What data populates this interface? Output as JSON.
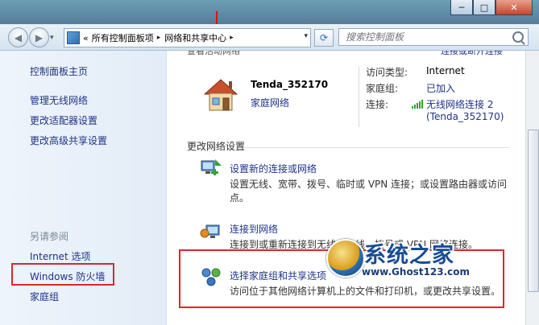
{
  "window": {
    "minimize": "─",
    "maximize": "□",
    "close": "✕"
  },
  "address": {
    "overflow": "«",
    "crumbs": [
      "所有控制面板项",
      "网络和共享中心"
    ],
    "separator": "▸",
    "search_placeholder": "搜索控制面板"
  },
  "sidebar": {
    "home": "控制面板主页",
    "tasks": [
      "管理无线网络",
      "更改适配器设置",
      "更改高级共享设置"
    ],
    "see_also_heading": "另请参阅",
    "see_also": [
      "Internet 选项",
      "Windows 防火墙",
      "家庭组"
    ]
  },
  "network": {
    "cut_left": "查看活动网络",
    "cut_right": "连接或断开连接",
    "name": "Tenda_352170",
    "type": "家庭网络",
    "access_type_label": "访问类型:",
    "access_type_value": "Internet",
    "homegroup_label": "家庭组:",
    "homegroup_value": "已加入",
    "connection_label": "连接:",
    "connection_value_line1": "无线网络连接 2",
    "connection_value_line2": "(Tenda_352170)"
  },
  "change_settings": {
    "heading": "更改网络设置",
    "tasks": [
      {
        "link": "设置新的连接或网络",
        "desc": "设置无线、宽带、拨号、临时或 VPN 连接；或设置路由器或访问点。"
      },
      {
        "link": "连接到网络",
        "desc": "连接到或重新连接到无线、有线、拨号或 VPN 网络连接。"
      },
      {
        "link": "选择家庭组和共享选项",
        "desc": "访问位于其他网络计算机上的文件和打印机，或更改共享设置。"
      }
    ]
  },
  "watermark": {
    "title": "系统之家",
    "url": "www.Ghost123.com"
  },
  "colors": {
    "link": "#1e3287",
    "highlight_border": "#e0252b",
    "signal": "#2da52a"
  }
}
